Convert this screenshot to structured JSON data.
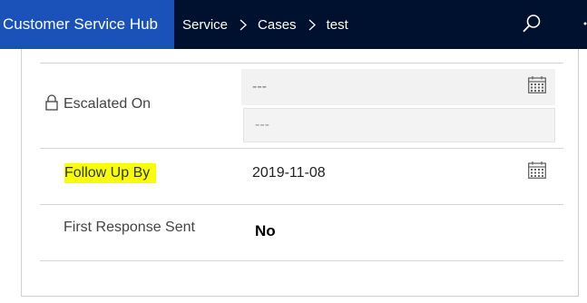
{
  "header": {
    "app_title": "Customer Service Hub",
    "breadcrumb": [
      "Service",
      "Cases",
      "test"
    ],
    "search_icon": "search-icon",
    "more_icon": "more-icon"
  },
  "form": {
    "escalated_on": {
      "label": "Escalated On",
      "locked": true,
      "date_value": "---",
      "time_value": "---",
      "icon": "calendar-icon"
    },
    "follow_up_by": {
      "label": "Follow Up By",
      "value": "2019-11-08",
      "highlight_color": "#f7ff00",
      "icon": "calendar-icon"
    },
    "first_response_sent": {
      "label": "First Response Sent",
      "value": "No"
    }
  },
  "colors": {
    "nav_background": "#00112f",
    "app_title_background": "#1a52b9"
  }
}
